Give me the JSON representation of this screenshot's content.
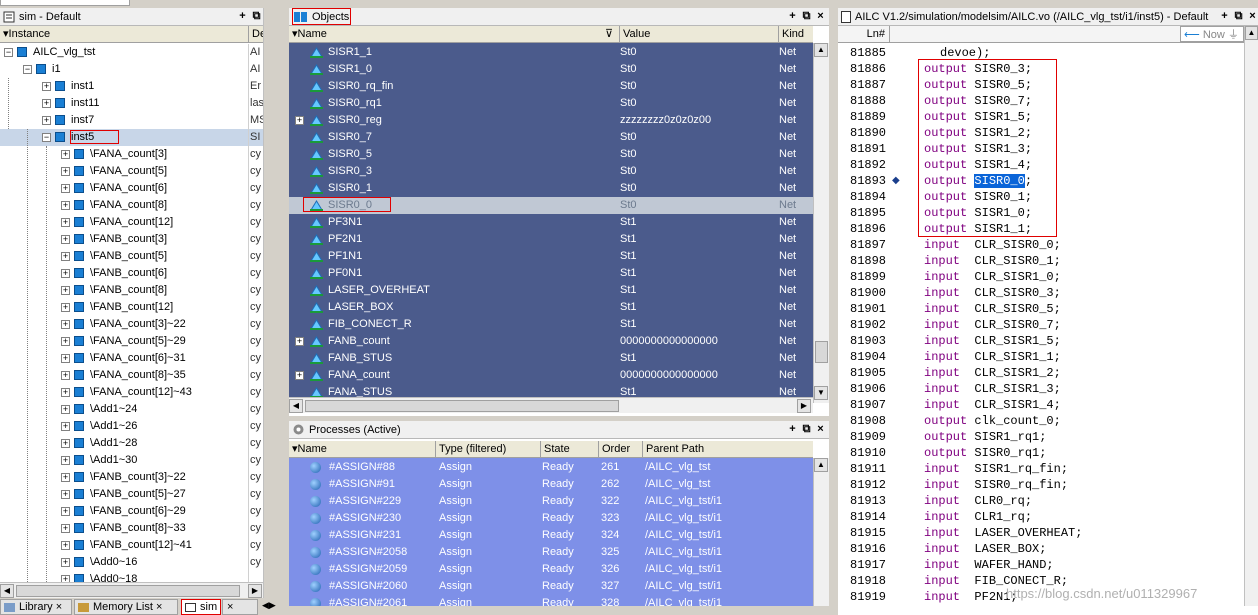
{
  "sim": {
    "title": "sim - Default",
    "col_instance": "Instance",
    "col_design": "De",
    "rows": [
      {
        "name": "AILC_vlg_tst",
        "d": "AI"
      },
      {
        "name": "i1",
        "d": "AI"
      },
      {
        "name": "inst1",
        "d": "Er"
      },
      {
        "name": "inst11",
        "d": "las"
      },
      {
        "name": "inst7",
        "d": "MS"
      },
      {
        "name": "inst5",
        "d": "SI"
      },
      {
        "name": "\\FANA_count[3]",
        "d": "cy"
      },
      {
        "name": "\\FANA_count[5]",
        "d": "cy"
      },
      {
        "name": "\\FANA_count[6]",
        "d": "cy"
      },
      {
        "name": "\\FANA_count[8]",
        "d": "cy"
      },
      {
        "name": "\\FANA_count[12]",
        "d": "cy"
      },
      {
        "name": "\\FANB_count[3]",
        "d": "cy"
      },
      {
        "name": "\\FANB_count[5]",
        "d": "cy"
      },
      {
        "name": "\\FANB_count[6]",
        "d": "cy"
      },
      {
        "name": "\\FANB_count[8]",
        "d": "cy"
      },
      {
        "name": "\\FANB_count[12]",
        "d": "cy"
      },
      {
        "name": "\\FANA_count[3]~22",
        "d": "cy"
      },
      {
        "name": "\\FANA_count[5]~29",
        "d": "cy"
      },
      {
        "name": "\\FANA_count[6]~31",
        "d": "cy"
      },
      {
        "name": "\\FANA_count[8]~35",
        "d": "cy"
      },
      {
        "name": "\\FANA_count[12]~43",
        "d": "cy"
      },
      {
        "name": "\\Add1~24",
        "d": "cy"
      },
      {
        "name": "\\Add1~26",
        "d": "cy"
      },
      {
        "name": "\\Add1~28",
        "d": "cy"
      },
      {
        "name": "\\Add1~30",
        "d": "cy"
      },
      {
        "name": "\\FANB_count[3]~22",
        "d": "cy"
      },
      {
        "name": "\\FANB_count[5]~27",
        "d": "cy"
      },
      {
        "name": "\\FANB_count[6]~29",
        "d": "cy"
      },
      {
        "name": "\\FANB_count[8]~33",
        "d": "cy"
      },
      {
        "name": "\\FANB_count[12]~41",
        "d": "cy"
      },
      {
        "name": "\\Add0~16",
        "d": "cy"
      },
      {
        "name": "\\Add0~18",
        "d": ""
      }
    ]
  },
  "objects": {
    "title": "Objects",
    "col_name": "Name",
    "col_value": "Value",
    "col_kind": "Kind",
    "rows": [
      {
        "name": "SISR1_1",
        "value": "St0",
        "kind": "Net",
        "plus": false
      },
      {
        "name": "SISR1_0",
        "value": "St0",
        "kind": "Net",
        "plus": false
      },
      {
        "name": "SISR0_rq_fin",
        "value": "St0",
        "kind": "Net",
        "plus": false
      },
      {
        "name": "SISR0_rq1",
        "value": "St0",
        "kind": "Net",
        "plus": false
      },
      {
        "name": "SISR0_reg",
        "value": "zzzzzzzz0z0z0z00",
        "kind": "Net",
        "plus": true
      },
      {
        "name": "SISR0_7",
        "value": "St0",
        "kind": "Net",
        "plus": false
      },
      {
        "name": "SISR0_5",
        "value": "St0",
        "kind": "Net",
        "plus": false
      },
      {
        "name": "SISR0_3",
        "value": "St0",
        "kind": "Net",
        "plus": false
      },
      {
        "name": "SISR0_1",
        "value": "St0",
        "kind": "Net",
        "plus": false
      },
      {
        "name": "SISR0_0",
        "value": "St0",
        "kind": "Net",
        "plus": false
      },
      {
        "name": "PF3N1",
        "value": "St1",
        "kind": "Net",
        "plus": false
      },
      {
        "name": "PF2N1",
        "value": "St1",
        "kind": "Net",
        "plus": false
      },
      {
        "name": "PF1N1",
        "value": "St1",
        "kind": "Net",
        "plus": false
      },
      {
        "name": "PF0N1",
        "value": "St1",
        "kind": "Net",
        "plus": false
      },
      {
        "name": "LASER_OVERHEAT",
        "value": "St1",
        "kind": "Net",
        "plus": false
      },
      {
        "name": "LASER_BOX",
        "value": "St1",
        "kind": "Net",
        "plus": false
      },
      {
        "name": "FIB_CONECT_R",
        "value": "St1",
        "kind": "Net",
        "plus": false
      },
      {
        "name": "FANB_count",
        "value": "0000000000000000",
        "kind": "Net",
        "plus": true
      },
      {
        "name": "FANB_STUS",
        "value": "St1",
        "kind": "Net",
        "plus": false
      },
      {
        "name": "FANA_count",
        "value": "0000000000000000",
        "kind": "Net",
        "plus": true
      },
      {
        "name": "FANA_STUS",
        "value": "St1",
        "kind": "Net",
        "plus": false
      }
    ]
  },
  "processes": {
    "title": "Processes (Active)",
    "col_name": "Name",
    "col_type": "Type (filtered)",
    "col_state": "State",
    "col_order": "Order",
    "col_parent": "Parent Path",
    "rows": [
      {
        "name": "#ASSIGN#88",
        "type": "Assign",
        "state": "Ready",
        "order": "261",
        "parent": "/AILC_vlg_tst"
      },
      {
        "name": "#ASSIGN#91",
        "type": "Assign",
        "state": "Ready",
        "order": "262",
        "parent": "/AILC_vlg_tst"
      },
      {
        "name": "#ASSIGN#229",
        "type": "Assign",
        "state": "Ready",
        "order": "322",
        "parent": "/AILC_vlg_tst/i1"
      },
      {
        "name": "#ASSIGN#230",
        "type": "Assign",
        "state": "Ready",
        "order": "323",
        "parent": "/AILC_vlg_tst/i1"
      },
      {
        "name": "#ASSIGN#231",
        "type": "Assign",
        "state": "Ready",
        "order": "324",
        "parent": "/AILC_vlg_tst/i1"
      },
      {
        "name": "#ASSIGN#2058",
        "type": "Assign",
        "state": "Ready",
        "order": "325",
        "parent": "/AILC_vlg_tst/i1"
      },
      {
        "name": "#ASSIGN#2059",
        "type": "Assign",
        "state": "Ready",
        "order": "326",
        "parent": "/AILC_vlg_tst/i1"
      },
      {
        "name": "#ASSIGN#2060",
        "type": "Assign",
        "state": "Ready",
        "order": "327",
        "parent": "/AILC_vlg_tst/i1"
      },
      {
        "name": "#ASSIGN#2061",
        "type": "Assign",
        "state": "Ready",
        "order": "328",
        "parent": "/AILC_vlg_tst/i1"
      }
    ]
  },
  "source": {
    "title": "AILC V1.2/simulation/modelsim/AILC.vo (/AILC_vlg_tst/i1/inst5) - Default",
    "col_ln": "Ln#",
    "now_label": "Now",
    "lines": [
      {
        "n": "81885",
        "kw": "",
        "rest": "devoe);"
      },
      {
        "n": "81886",
        "kw": "output",
        "rest": " SISR0_3;"
      },
      {
        "n": "81887",
        "kw": "output",
        "rest": " SISR0_5;"
      },
      {
        "n": "81888",
        "kw": "output",
        "rest": " SISR0_7;"
      },
      {
        "n": "81889",
        "kw": "output",
        "rest": " SISR1_5;"
      },
      {
        "n": "81890",
        "kw": "output",
        "rest": " SISR1_2;"
      },
      {
        "n": "81891",
        "kw": "output",
        "rest": " SISR1_3;"
      },
      {
        "n": "81892",
        "kw": "output",
        "rest": " SISR1_4;"
      },
      {
        "n": "81893",
        "kw": "output",
        "rest": " SISR0_0;"
      },
      {
        "n": "81894",
        "kw": "output",
        "rest": " SISR0_1;"
      },
      {
        "n": "81895",
        "kw": "output",
        "rest": " SISR1_0;"
      },
      {
        "n": "81896",
        "kw": "output",
        "rest": " SISR1_1;"
      },
      {
        "n": "81897",
        "kw": "input",
        "rest": "  CLR_SISR0_0;"
      },
      {
        "n": "81898",
        "kw": "input",
        "rest": "  CLR_SISR0_1;"
      },
      {
        "n": "81899",
        "kw": "input",
        "rest": "  CLR_SISR1_0;"
      },
      {
        "n": "81900",
        "kw": "input",
        "rest": "  CLR_SISR0_3;"
      },
      {
        "n": "81901",
        "kw": "input",
        "rest": "  CLR_SISR0_5;"
      },
      {
        "n": "81902",
        "kw": "input",
        "rest": "  CLR_SISR0_7;"
      },
      {
        "n": "81903",
        "kw": "input",
        "rest": "  CLR_SISR1_5;"
      },
      {
        "n": "81904",
        "kw": "input",
        "rest": "  CLR_SISR1_1;"
      },
      {
        "n": "81905",
        "kw": "input",
        "rest": "  CLR_SISR1_2;"
      },
      {
        "n": "81906",
        "kw": "input",
        "rest": "  CLR_SISR1_3;"
      },
      {
        "n": "81907",
        "kw": "input",
        "rest": "  CLR_SISR1_4;"
      },
      {
        "n": "81908",
        "kw": "output",
        "rest": " clk_count_0;"
      },
      {
        "n": "81909",
        "kw": "output",
        "rest": " SISR1_rq1;"
      },
      {
        "n": "81910",
        "kw": "output",
        "rest": " SISR0_rq1;"
      },
      {
        "n": "81911",
        "kw": "input",
        "rest": "  SISR1_rq_fin;"
      },
      {
        "n": "81912",
        "kw": "input",
        "rest": "  SISR0_rq_fin;"
      },
      {
        "n": "81913",
        "kw": "input",
        "rest": "  CLR0_rq;"
      },
      {
        "n": "81914",
        "kw": "input",
        "rest": "  CLR1_rq;"
      },
      {
        "n": "81915",
        "kw": "input",
        "rest": "  LASER_OVERHEAT;"
      },
      {
        "n": "81916",
        "kw": "input",
        "rest": "  LASER_BOX;"
      },
      {
        "n": "81917",
        "kw": "input",
        "rest": "  WAFER_HAND;"
      },
      {
        "n": "81918",
        "kw": "input",
        "rest": "  FIB_CONECT_R;"
      },
      {
        "n": "81919",
        "kw": "input",
        "rest": "  PF2N1;"
      }
    ]
  },
  "tabs": {
    "library": "Library",
    "memory": "Memory List",
    "sim": "sim"
  },
  "watermark": "https://blog.csdn.net/u011329967",
  "colors": {
    "objects_bg": "#4b5b8c",
    "processes_bg": "#7e90e8",
    "highlight": "#0a64d8",
    "annotation": "#e00000"
  }
}
